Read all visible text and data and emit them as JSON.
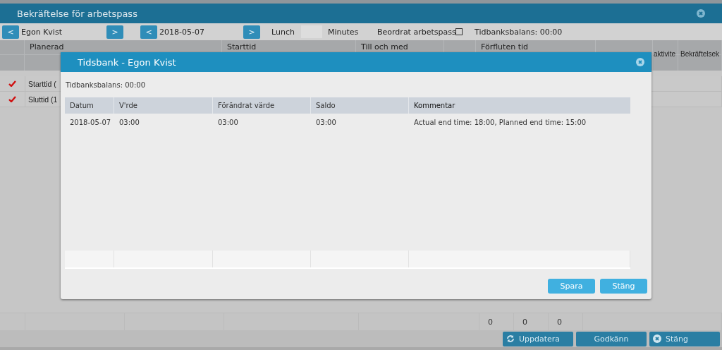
{
  "window": {
    "title": "Bekräftelse för arbetspass"
  },
  "toolbar": {
    "prev_label": "<",
    "employee": "Egon Kvist",
    "next_label": ">",
    "date_prev_label": "<",
    "date": "2018-05-07",
    "date_next_label": ">",
    "lunch_label": "Lunch",
    "minutes_label": "Minutes",
    "ordered_label": "Beordrat arbetspass",
    "ordered_checked": false,
    "balance": "Tidbanksbalans: 00:00"
  },
  "grid": {
    "columns": [
      "",
      "Planerad",
      "Starttid",
      "Till och med",
      "",
      "Förfluten tid",
      "",
      "aktivite",
      "Bekräftelsek"
    ],
    "rows": [
      {
        "confirmed": true,
        "label": "Starttid ("
      },
      {
        "confirmed": true,
        "label": "Sluttid (1"
      }
    ],
    "totals": [
      "0",
      "0",
      "0"
    ]
  },
  "footer_buttons": [
    {
      "kind": "refresh",
      "label": "Uppdatera"
    },
    {
      "kind": "plain",
      "label": "Godkänn"
    },
    {
      "kind": "close",
      "label": "Stäng"
    }
  ],
  "dialog": {
    "title": "Tidsbank - Egon Kvist",
    "balance": "Tidbanksbalans: 00:00",
    "columns": [
      "Datum",
      "V'rde",
      "Förändrat värde",
      "Saldo",
      "Kommentar"
    ],
    "rows": [
      [
        "2018-05-07",
        "03:00",
        "03:00",
        "03:00",
        "Actual end time: 18:00, Planned end time: 15:00"
      ]
    ],
    "buttons": [
      "Spara",
      "Stäng"
    ]
  }
}
